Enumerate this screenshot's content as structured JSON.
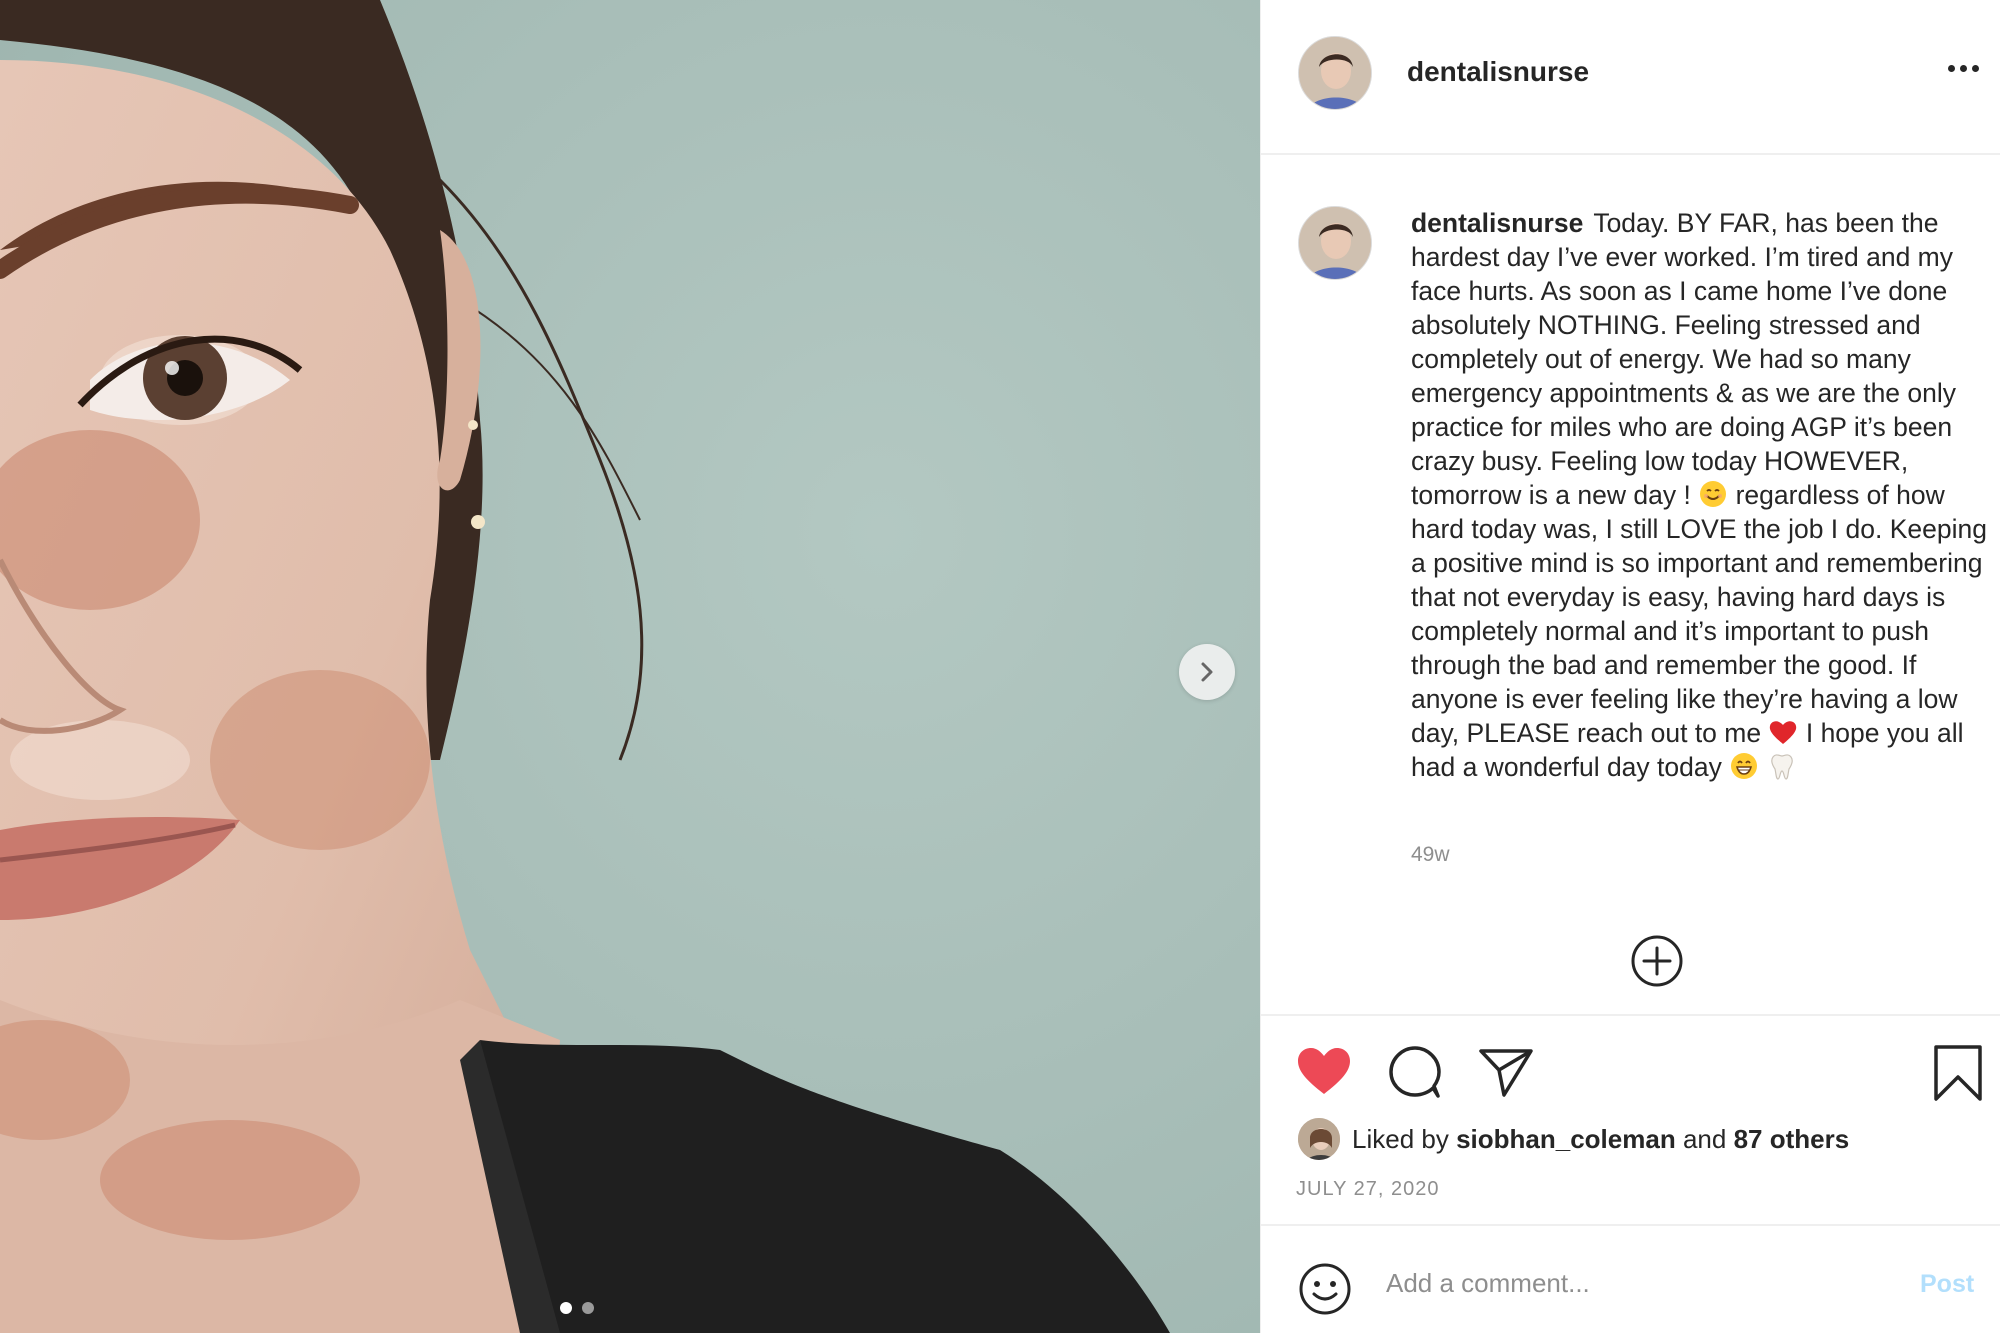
{
  "post": {
    "username": "dentalisnurse",
    "more_icon": "more-horizontal-icon",
    "caption_user": "dentalisnurse",
    "caption_part1": "Today. BY FAR, has been the hardest day I’ve ever worked. I’m tired and my face hurts. As soon as I came home I’ve done absolutely NOTHING. Feeling stressed and completely out of energy. We had so many emergency appointments & as we are the only practice for miles who are doing AGP it’s been crazy busy. Feeling low today HOWEVER, tomorrow is a new day !",
    "caption_part2": "regardless of how hard today was, I still LOVE the job I do. Keeping a positive mind is so important and remembering that not everyday is easy, having hard days is completely normal and it’s important to push through the bad and remember the good. If anyone is ever feeling like they’re having a low day, PLEASE reach out to me",
    "caption_part3": "I hope you all had a wonderful day today",
    "time_ago": "49w",
    "likes_prefix": "Liked by",
    "liked_by_user": "siobhan_coleman",
    "likes_and": "and",
    "likes_others": "87 others",
    "date": "JULY 27, 2020"
  },
  "carousel": {
    "total_slides": 2,
    "active_slide": 1
  },
  "comment_box": {
    "placeholder": "Add a comment...",
    "post_label": "Post"
  },
  "colors": {
    "like_red": "#ed4956",
    "post_disabled_blue": "#b2dffc",
    "text": "#262626",
    "muted": "#8e8e8e"
  },
  "icons": {
    "next": "chevron-right-icon",
    "load_more": "plus-circle-icon",
    "like": "heart-filled-icon",
    "comment": "comment-bubble-icon",
    "share": "paper-plane-icon",
    "save": "bookmark-icon",
    "emoji": "smiley-face-icon"
  }
}
